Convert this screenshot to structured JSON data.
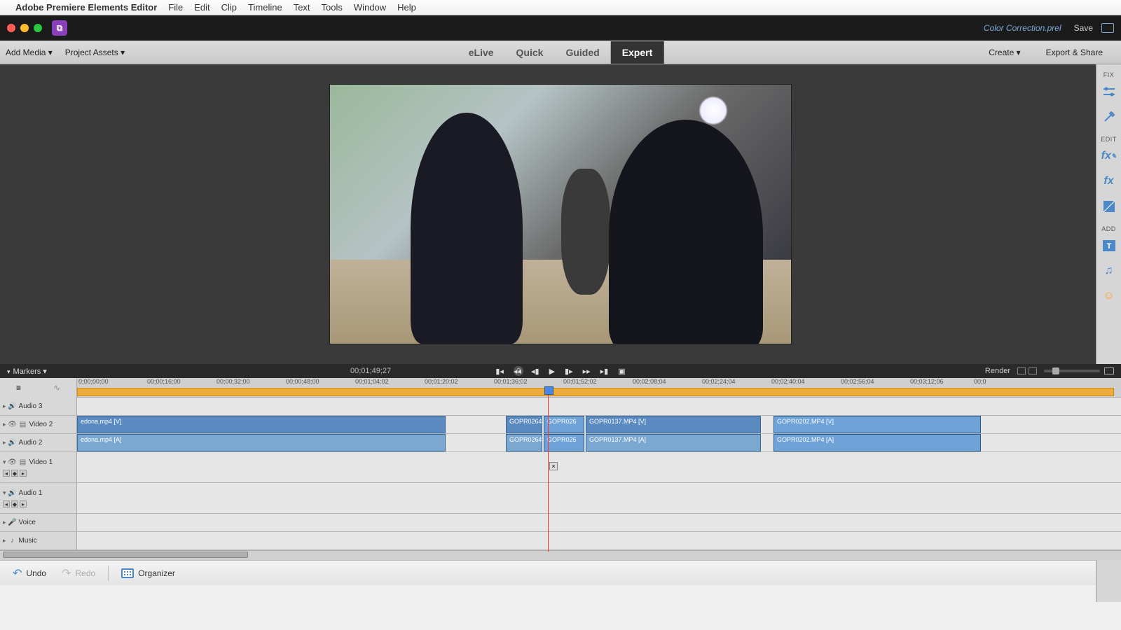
{
  "mac_menu": {
    "app_name": "Adobe Premiere Elements Editor",
    "items": [
      "File",
      "Edit",
      "Clip",
      "Timeline",
      "Text",
      "Tools",
      "Window",
      "Help"
    ]
  },
  "title": {
    "project": "Color Correction.prel",
    "save": "Save"
  },
  "toolbar": {
    "add_media": "Add Media ▾",
    "project_assets": "Project Assets ▾",
    "tabs": {
      "elive": "eLive",
      "quick": "Quick",
      "guided": "Guided",
      "expert": "Expert"
    },
    "create": "Create ▾",
    "export": "Export & Share"
  },
  "right_rail": {
    "fix_label": "FIX",
    "edit_label": "EDIT",
    "add_label": "ADD"
  },
  "playbar": {
    "markers": "Markers  ▾",
    "timecode": "00;01;49;27",
    "render": "Render"
  },
  "ruler": {
    "ticks": [
      "0;00;00;00",
      "00;00;16;00",
      "00;00;32;00",
      "00;00;48;00",
      "00;01;04;02",
      "00;01;20;02",
      "00;01;36;02",
      "00;01;52;02",
      "00;02;08;04",
      "00;02;24;04",
      "00;02;40;04",
      "00;02;56;04",
      "00;03;12;06",
      "00;0"
    ]
  },
  "tracks": {
    "audio3": "Audio 3",
    "video2": "Video 2",
    "audio2": "Audio 2",
    "video1": "Video 1",
    "audio1": "Audio 1",
    "voice": "Voice",
    "music": "Music"
  },
  "clips": {
    "v2_1": "edona.mp4 [V]",
    "a2_1": "edona.mp4 [A]",
    "v2_2": "GOPR0264.",
    "a2_2": "GOPR0264.",
    "v2_3": "GOPR026",
    "a2_3": "GOPR026",
    "v2_4": "GOPR0137.MP4 [V]",
    "a2_4": "GOPR0137.MP4 [A]",
    "v2_5": "GOPR0202.MP4 [V]",
    "a2_5": "GOPR0202.MP4 [A]"
  },
  "bottom": {
    "undo": "Undo",
    "redo": "Redo",
    "organizer": "Organizer"
  }
}
